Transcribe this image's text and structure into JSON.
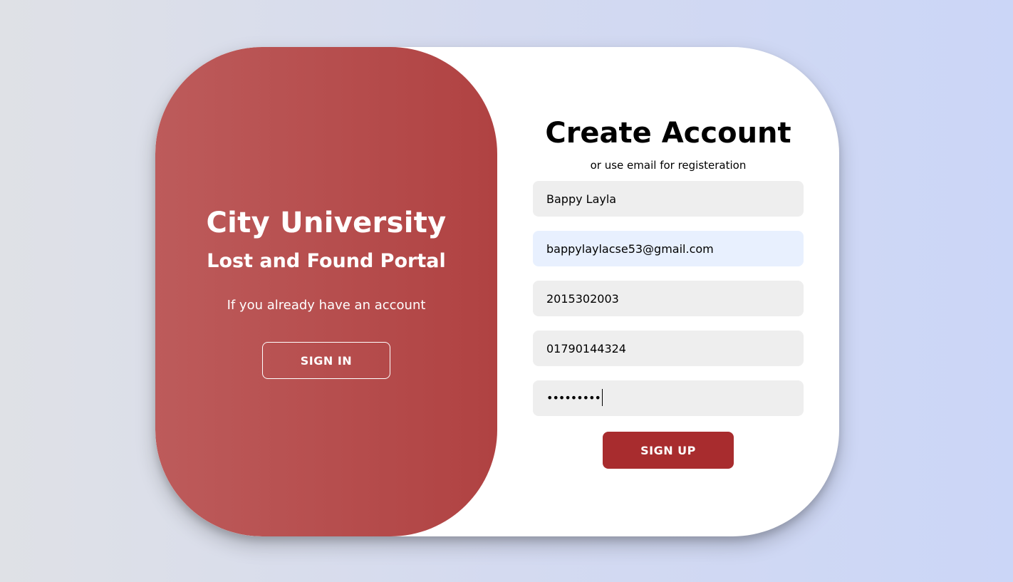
{
  "overlay": {
    "title": "City University",
    "subtitle": "Lost and Found Portal",
    "prompt": "If you already have an account",
    "sign_in_label": "SIGN IN"
  },
  "form": {
    "title": "Create Account",
    "subtitle": "or use email for registeration",
    "fields": [
      {
        "name": "name",
        "value": "Bappy Layla",
        "type": "text"
      },
      {
        "name": "email",
        "value": "bappylaylacse53@gmail.com",
        "type": "email"
      },
      {
        "name": "student_id",
        "value": "2015302003",
        "type": "text"
      },
      {
        "name": "phone",
        "value": "01790144324",
        "type": "text"
      },
      {
        "name": "password",
        "value": "•••••••••",
        "type": "password"
      }
    ],
    "sign_up_label": "SIGN UP"
  },
  "colors": {
    "accent": "#a82c2e",
    "overlay_start": "#bd5b5b",
    "overlay_end": "#b04242",
    "field_bg": "#eeeeee",
    "autofill_bg": "#e8f0fe"
  }
}
